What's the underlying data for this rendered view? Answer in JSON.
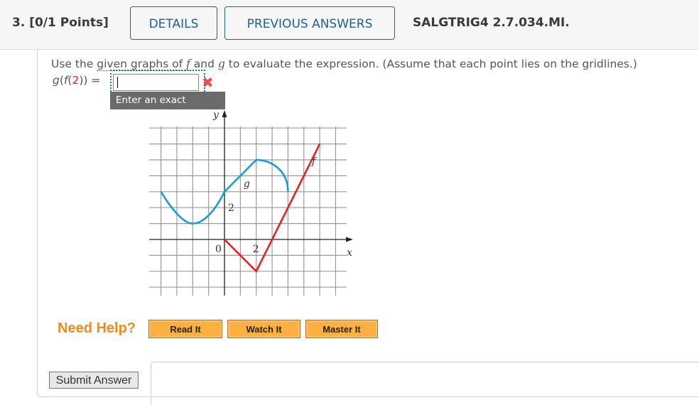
{
  "header": {
    "question_label": "3.  [0/1 Points]",
    "details_button": "DETAILS",
    "previous_answers_button": "PREVIOUS ANSWERS",
    "question_code": "SALGTRIG4 2.7.034.MI."
  },
  "question": {
    "prompt_parts": {
      "before": "Use the ",
      "link": "given graphs of ",
      "f": "f",
      "middle": " and ",
      "g": "g",
      "after": " to evaluate the expression. (Assume that each point lies on the gridlines.)"
    },
    "expression": {
      "outer_func": "g",
      "inner_func": "f",
      "argument": "2",
      "equals": "="
    },
    "answer_value": "",
    "answer_status": "incorrect",
    "tooltip": "Enter an exact number."
  },
  "chart_data": {
    "type": "line",
    "xlabel": "x",
    "ylabel": "y",
    "xlim": [
      -5,
      8
    ],
    "ylim": [
      -4,
      8
    ],
    "grid": true,
    "tick_labels": [
      {
        "text": "0",
        "x": 0,
        "y": 0
      },
      {
        "text": "2",
        "x": 2,
        "y": 0,
        "axis": "x"
      },
      {
        "text": "2",
        "x": 0,
        "y": 2,
        "axis": "y"
      }
    ],
    "series": [
      {
        "name": "g",
        "color": "#1a9be0",
        "points": [
          [
            -4,
            3
          ],
          [
            -3,
            1.6
          ],
          [
            -2,
            1
          ],
          [
            -1,
            1.6
          ],
          [
            0,
            3
          ],
          [
            1,
            4
          ],
          [
            2,
            5
          ],
          [
            3,
            4.6
          ],
          [
            3.7,
            4
          ],
          [
            4,
            3
          ]
        ],
        "label_at": [
          1.2,
          3.3
        ]
      },
      {
        "name": "f",
        "color": "#e8201e",
        "points": [
          [
            0,
            0
          ],
          [
            2,
            -2
          ],
          [
            6,
            6
          ]
        ],
        "label_at": [
          5.5,
          4.7
        ]
      }
    ]
  },
  "help": {
    "label": "Need Help?",
    "buttons": [
      "Read It",
      "Watch It",
      "Master It"
    ]
  },
  "submit_button": "Submit Answer"
}
